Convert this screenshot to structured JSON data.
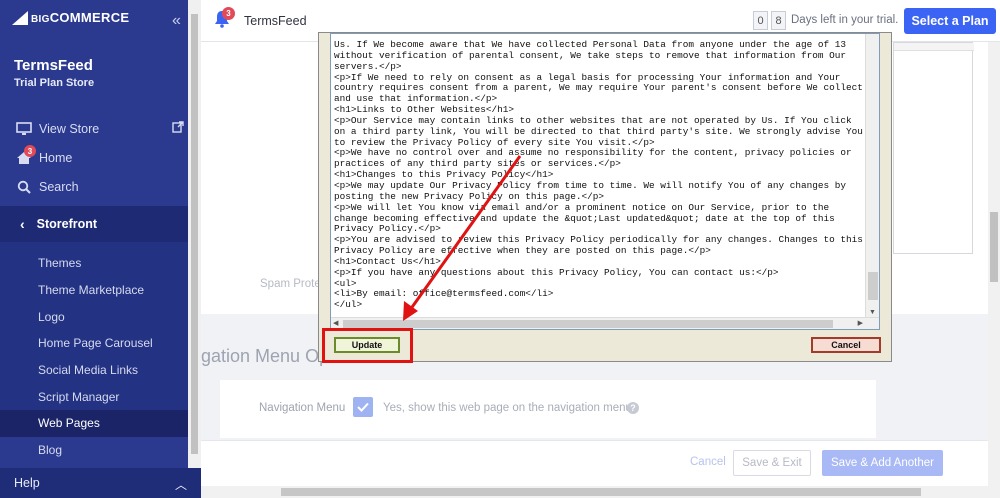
{
  "sidebar": {
    "logo": {
      "big": "BIG",
      "rest": "COMMERCE"
    },
    "store_name": "TermsFeed",
    "plan": "Trial Plan Store",
    "top_items": [
      {
        "label": "View Store",
        "icon": "monitor-icon"
      },
      {
        "label": "Home",
        "icon": "home-icon",
        "badge": "3"
      },
      {
        "label": "Search",
        "icon": "search-icon"
      }
    ],
    "section_title": "Storefront",
    "sub_items": [
      "Themes",
      "Theme Marketplace",
      "Logo",
      "Home Page Carousel",
      "Social Media Links",
      "Script Manager",
      "Web Pages",
      "Blog"
    ],
    "active_sub": "Web Pages",
    "help": "Help"
  },
  "topbar": {
    "notif_count": "3",
    "store": "TermsFeed",
    "trial_d1": "0",
    "trial_d2": "8",
    "trial_text": "Days left in your trial.",
    "select_plan": "Select a Plan"
  },
  "background": {
    "spam_label": "Spam Prote",
    "nav_options_title": "gation Menu Op",
    "nav_menu_label": "Navigation Menu",
    "nav_checkbox_text": "Yes, show this web page on the navigation menu",
    "help_q": "?",
    "cancel": "Cancel",
    "save_exit": "Save & Exit",
    "save_add": "Save & Add Another"
  },
  "dialog": {
    "code_lines": [
      "Us. If We become aware that We have collected Personal Data from anyone under the age of 13",
      "without verification of parental consent, We take steps to remove that information from Our",
      "servers.</p>",
      "<p>If We need to rely on consent as a legal basis for processing Your information and Your",
      "country requires consent from a parent, We may require Your parent's consent before We collect",
      "and use that information.</p>",
      "<h1>Links to Other Websites</h1>",
      "<p>Our Service may contain links to other websites that are not operated by Us. If You click",
      "on a third party link, You will be directed to that third party's site. We strongly advise You",
      "to review the Privacy Policy of every site You visit.</p>",
      "<p>We have no control over and assume no responsibility for the content, privacy policies or",
      "practices of any third party sites or services.</p>",
      "<h1>Changes to this Privacy Policy</h1>",
      "<p>We may update Our Privacy Policy from time to time. We will notify You of any changes by",
      "posting the new Privacy Policy on this page.</p>",
      "<p>We will let You know via email and/or a prominent notice on Our Service, prior to the",
      "change becoming effective and update the &quot;Last updated&quot; date at the top of this",
      "Privacy Policy.</p>",
      "<p>You are advised to review this Privacy Policy periodically for any changes. Changes to this",
      "Privacy Policy are effective when they are posted on this page.</p>",
      "<h1>Contact Us</h1>",
      "<p>If you have any questions about this Privacy Policy, You can contact us:</p>",
      "<ul>",
      "<li>By email: office@termsfeed.com</li>",
      "</ul>"
    ],
    "update": "Update",
    "cancel": "Cancel"
  },
  "colors": {
    "sidebar": "#2b3a8f",
    "accent": "#3c64f4",
    "annotation": "#e01212"
  }
}
